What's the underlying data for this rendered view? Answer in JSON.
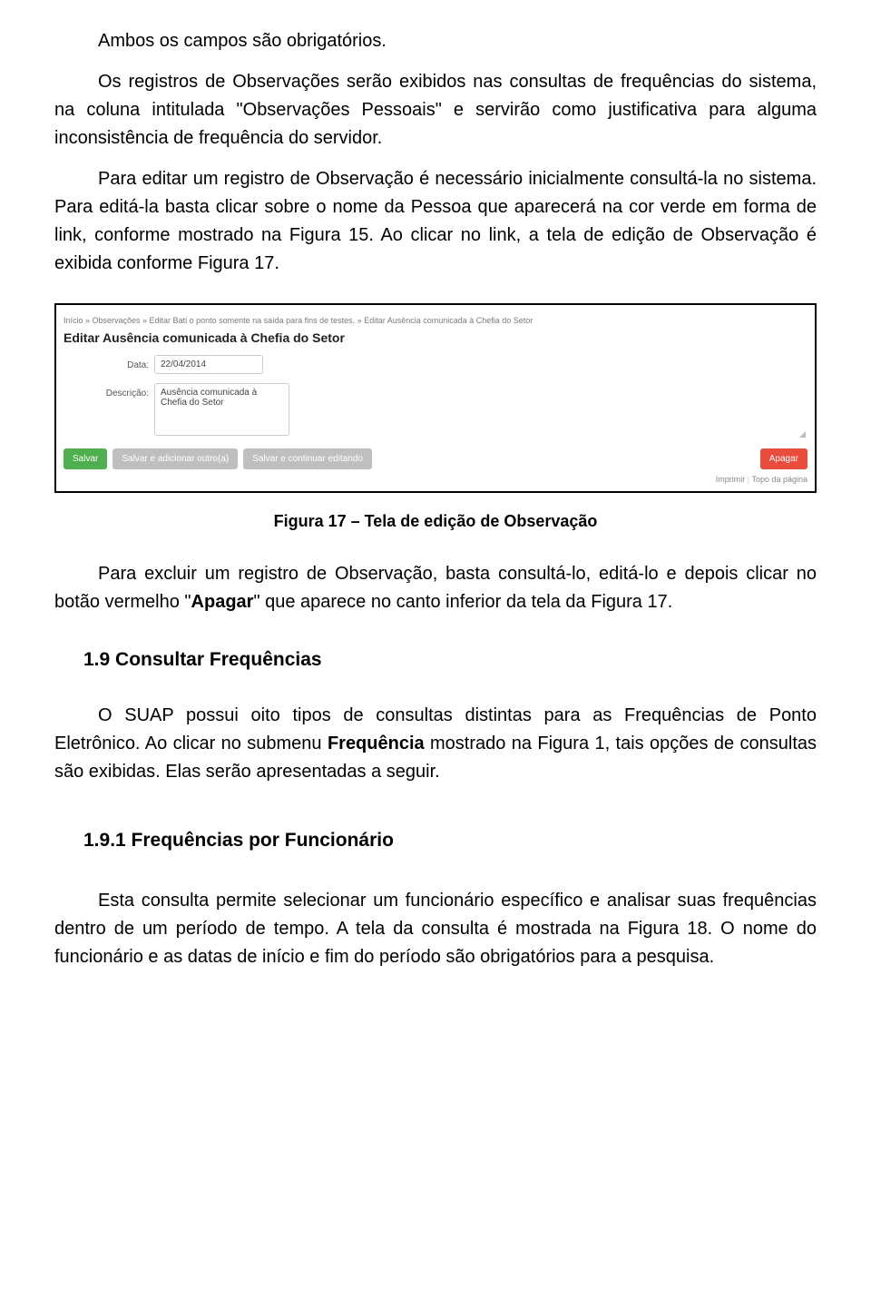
{
  "p1": "Ambos os campos são obrigatórios.",
  "p2": "Os registros de Observações serão exibidos nas consultas de frequências do sistema, na coluna intitulada \"Observações Pessoais\" e servirão como justificativa para alguma inconsistência de frequência do servidor.",
  "p3": "Para editar um registro de Observação é necessário inicialmente consultá-la no sistema. Para editá-la basta clicar sobre o nome da Pessoa que aparecerá na cor verde em forma de link, conforme mostrado na Figura 15. Ao clicar no link, a tela de edição de Observação é exibida conforme Figura 17.",
  "shot": {
    "breadcrumb": "Início  »  Observações  »  Editar Bati o ponto somente na saída para fins de testes.  »  Editar Ausência comunicada à Chefia do Setor",
    "title": "Editar Ausência comunicada à Chefia do Setor",
    "data_label": "Data:",
    "data_value": "22/04/2014",
    "desc_label": "Descrição:",
    "desc_value": "Ausência comunicada à Chefia do Setor",
    "btn_save": "Salvar",
    "btn_save_add": "Salvar e adicionar outro(a)",
    "btn_save_cont": "Salvar e continuar editando",
    "btn_delete": "Apagar",
    "footer_print": "Imprimir",
    "footer_top": "Topo da página"
  },
  "figcap": "Figura 17 – Tela de edição de Observação",
  "p4a": "Para excluir um registro de Observação, basta consultá-lo, editá-lo e depois clicar no botão vermelho \"",
  "p4bold": "Apagar",
  "p4b": "\" que aparece no canto inferior da tela da Figura 17.",
  "h2": "1.9 Consultar Frequências",
  "p5a": "O SUAP possui oito tipos de consultas distintas para as Frequências de Ponto Eletrônico. Ao clicar no submenu ",
  "p5bold": "Frequência",
  "p5b": " mostrado na Figura 1, tais opções de consultas são exibidas. Elas serão apresentadas a seguir.",
  "h3": "1.9.1 Frequências por Funcionário",
  "p6": "Esta consulta permite selecionar um funcionário específico e analisar suas frequências dentro de um período de tempo. A tela da consulta é mostrada na Figura 18. O nome do funcionário e as datas de início e fim do período são obrigatórios para a pesquisa."
}
